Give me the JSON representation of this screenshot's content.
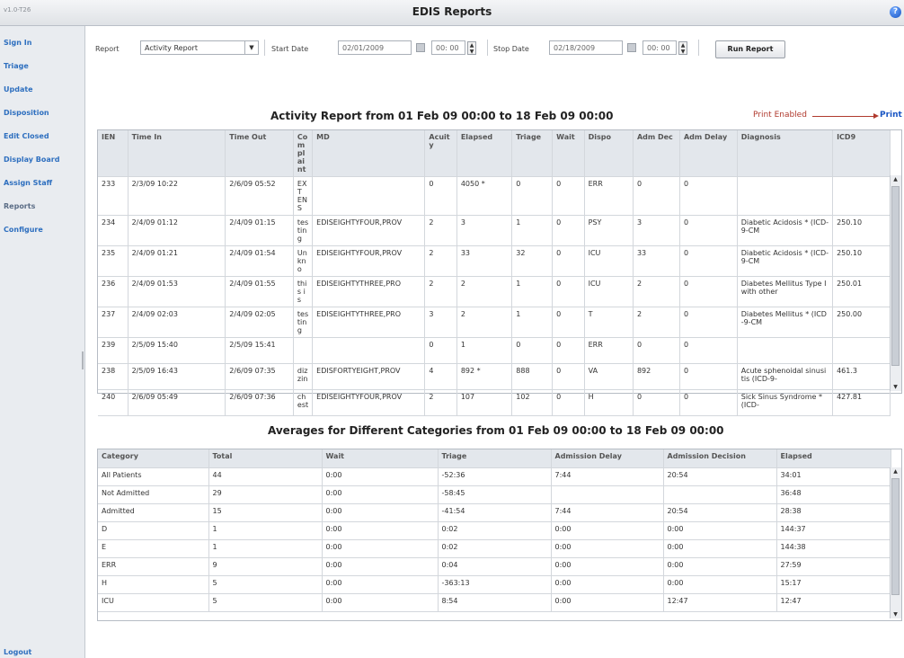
{
  "app": {
    "version": "v1.0-T26",
    "title": "EDIS Reports",
    "help_icon": "?"
  },
  "sidebar": {
    "items": [
      {
        "label": "Sign In"
      },
      {
        "label": "Triage"
      },
      {
        "label": "Update"
      },
      {
        "label": "Disposition"
      },
      {
        "label": "Edit Closed"
      },
      {
        "label": "Display Board"
      },
      {
        "label": "Assign Staff"
      },
      {
        "label": "Reports"
      },
      {
        "label": "Configure"
      }
    ],
    "logout": "Logout"
  },
  "toolbar": {
    "report_label": "Report",
    "report_value": "Activity Report",
    "start_label": "Start Date",
    "start_date": "02/01/2009",
    "start_time": "00: 00",
    "stop_label": "Stop Date",
    "stop_date": "02/18/2009",
    "stop_time": "00: 00",
    "run_label": "Run Report"
  },
  "activity": {
    "title": "Activity Report from 01 Feb 09 00:00 to 18 Feb 09 00:00",
    "print_enabled": "Print Enabled",
    "print_link": "Print",
    "columns": [
      "IEN",
      "Time In",
      "Time Out",
      "Complaint",
      "MD",
      "Acuity",
      "Elapsed",
      "Triage",
      "Wait",
      "Dispo",
      "Adm Dec",
      "Adm Delay",
      "Diagnosis",
      "ICD9"
    ],
    "rows": [
      [
        "233",
        "2/3/09 10:22",
        "2/6/09 05:52",
        "EXT ENS",
        "",
        "0",
        "4050 *",
        "0",
        "0",
        "ERR",
        "0",
        "0",
        "",
        ""
      ],
      [
        "234",
        "2/4/09 01:12",
        "2/4/09 01:15",
        "testing",
        "EDISEIGHTYFOUR,PROV",
        "2",
        "3",
        "1",
        "0",
        "PSY",
        "3",
        "0",
        "Diabetic Acidosis * (ICD-9-CM",
        "250.10"
      ],
      [
        "235",
        "2/4/09 01:21",
        "2/4/09 01:54",
        "Unkno",
        "EDISEIGHTYFOUR,PROV",
        "2",
        "33",
        "32",
        "0",
        "ICU",
        "33",
        "0",
        "Diabetic Acidosis * (ICD-9-CM",
        "250.10"
      ],
      [
        "236",
        "2/4/09 01:53",
        "2/4/09 01:55",
        "this is",
        "EDISEIGHTYTHREE,PRO",
        "2",
        "2",
        "1",
        "0",
        "ICU",
        "2",
        "0",
        "Diabetes Mellitus Type I with other",
        "250.01"
      ],
      [
        "237",
        "2/4/09 02:03",
        "2/4/09 02:05",
        "testing",
        "EDISEIGHTYTHREE,PRO",
        "3",
        "2",
        "1",
        "0",
        "T",
        "2",
        "0",
        "Diabetes Mellitus * (ICD-9-CM",
        "250.00"
      ],
      [
        "239",
        "2/5/09 15:40",
        "2/5/09 15:41",
        "",
        "",
        "0",
        "1",
        "0",
        "0",
        "ERR",
        "0",
        "0",
        "",
        ""
      ],
      [
        "238",
        "2/5/09 16:43",
        "2/6/09 07:35",
        "dizzin",
        "EDISFORTYEIGHT,PROV",
        "4",
        "892 *",
        "888",
        "0",
        "VA",
        "892",
        "0",
        "Acute sphenoidal sinusitis (ICD-9-",
        "461.3"
      ],
      [
        "240",
        "2/6/09 05:49",
        "2/6/09 07:36",
        "chest",
        "EDISEIGHTYFOUR,PROV",
        "2",
        "107",
        "102",
        "0",
        "H",
        "0",
        "0",
        "Sick Sinus Syndrome * (ICD-",
        "427.81"
      ]
    ]
  },
  "averages": {
    "title": "Averages for Different Categories from 01 Feb 09 00:00 to 18 Feb 09 00:00",
    "columns": [
      "Category",
      "Total",
      "Wait",
      "Triage",
      "Admission Delay",
      "Admission Decision",
      "Elapsed"
    ],
    "rows": [
      [
        "All Patients",
        "44",
        "0:00",
        "-52:36",
        "7:44",
        "20:54",
        "34:01"
      ],
      [
        "Not Admitted",
        "29",
        "0:00",
        "-58:45",
        "",
        "",
        "36:48"
      ],
      [
        "Admitted",
        "15",
        "0:00",
        "-41:54",
        "7:44",
        "20:54",
        "28:38"
      ],
      [
        "D",
        "1",
        "0:00",
        "0:02",
        "0:00",
        "0:00",
        "144:37"
      ],
      [
        "E",
        "1",
        "0:00",
        "0:02",
        "0:00",
        "0:00",
        "144:38"
      ],
      [
        "ERR",
        "9",
        "0:00",
        "0:04",
        "0:00",
        "0:00",
        "27:59"
      ],
      [
        "H",
        "5",
        "0:00",
        "-363:13",
        "0:00",
        "0:00",
        "15:17"
      ],
      [
        "ICU",
        "5",
        "0:00",
        "8:54",
        "0:00",
        "12:47",
        "12:47"
      ]
    ]
  }
}
